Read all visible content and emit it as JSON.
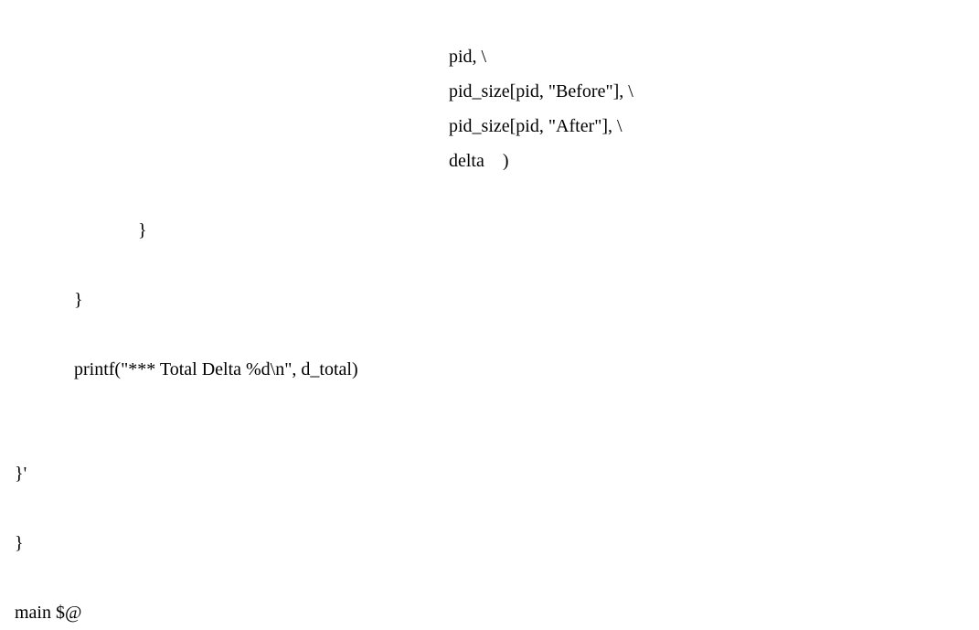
{
  "code": {
    "line1": "                                                                                               pid, \\",
    "line2": "                                                                                               pid_size[pid, \"Before\"], \\",
    "line3": "                                                                                               pid_size[pid, \"After\"], \\",
    "line4": "                                                                                               delta    )",
    "line5": "",
    "line6": "                           }",
    "line7": "",
    "line8": "             }",
    "line9": "",
    "line10": "             printf(\"*** Total Delta %d\\n\", d_total)",
    "line11": "",
    "line12": "",
    "line13": "}'",
    "line14": "",
    "line15": "}",
    "line16": "",
    "line17": "main $@"
  }
}
